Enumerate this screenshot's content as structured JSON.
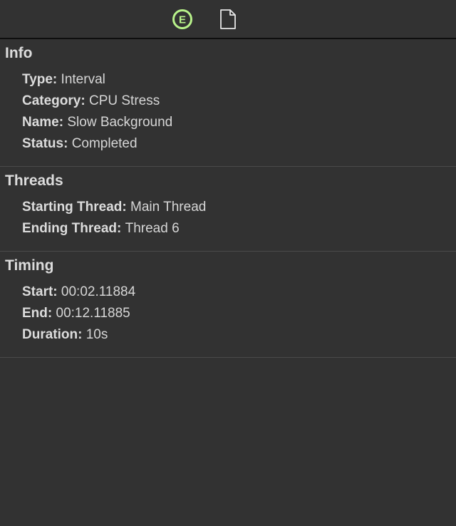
{
  "toolbar": {
    "event_icon_letter": "E",
    "event_icon_color": "#b8f28a",
    "document_icon": "document-icon"
  },
  "sections": {
    "info": {
      "title": "Info",
      "rows": [
        {
          "key": "Type:",
          "value": "Interval"
        },
        {
          "key": "Category:",
          "value": "CPU Stress"
        },
        {
          "key": "Name:",
          "value": "Slow Background"
        },
        {
          "key": "Status:",
          "value": "Completed"
        }
      ]
    },
    "threads": {
      "title": "Threads",
      "rows": [
        {
          "key": "Starting Thread:",
          "value": "Main Thread"
        },
        {
          "key": "Ending Thread:",
          "value": "Thread 6"
        }
      ]
    },
    "timing": {
      "title": "Timing",
      "rows": [
        {
          "key": "Start:",
          "value": "00:02.11884"
        },
        {
          "key": "End:",
          "value": "00:12.11885"
        },
        {
          "key": "Duration:",
          "value": "10s"
        }
      ]
    }
  }
}
